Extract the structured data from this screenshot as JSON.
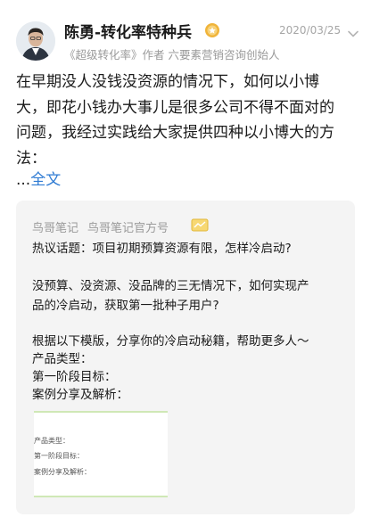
{
  "post": {
    "author_name": "陈勇-转化率特种兵",
    "author_subtitle": "《超级转化率》作者 六要素营销咨询创始人",
    "date": "2020/03/25",
    "body_lines": [
      "在早期没人没钱没资源的情况下，如何以小博",
      "大，即花小钱办大事儿是很多公司不得不面对的",
      "问题，我经过实践给大家提供四种以小博大的方",
      "法："
    ],
    "ellipsis": "...",
    "full_text_link": "全文"
  },
  "card": {
    "source_name": "鸟哥笔记",
    "account_name": "鸟哥笔记官方号",
    "lines": [
      "热议话题：项目初期预算资源有限，怎样冷启动?",
      "没预算、没资源、没品牌的三无情况下，如何实现产",
      "品的冷启动，获取第一批种子用户?",
      "根据以下模版，分享你的冷启动秘籍，帮助更多人～",
      "产品类型：",
      "第一阶段目标：",
      "案例分享及解析："
    ],
    "thumbnail_lines": [
      "产品类型：",
      "第一阶段目标：",
      "案例分享及解析："
    ]
  },
  "colors": {
    "link": "#2f7bd3",
    "badge": "#f0b43a",
    "card_bg": "#f4f4f4",
    "muted": "#9a9a9a"
  },
  "icons": [
    "verified-badge-icon",
    "chevron-down-icon",
    "book-icon"
  ]
}
